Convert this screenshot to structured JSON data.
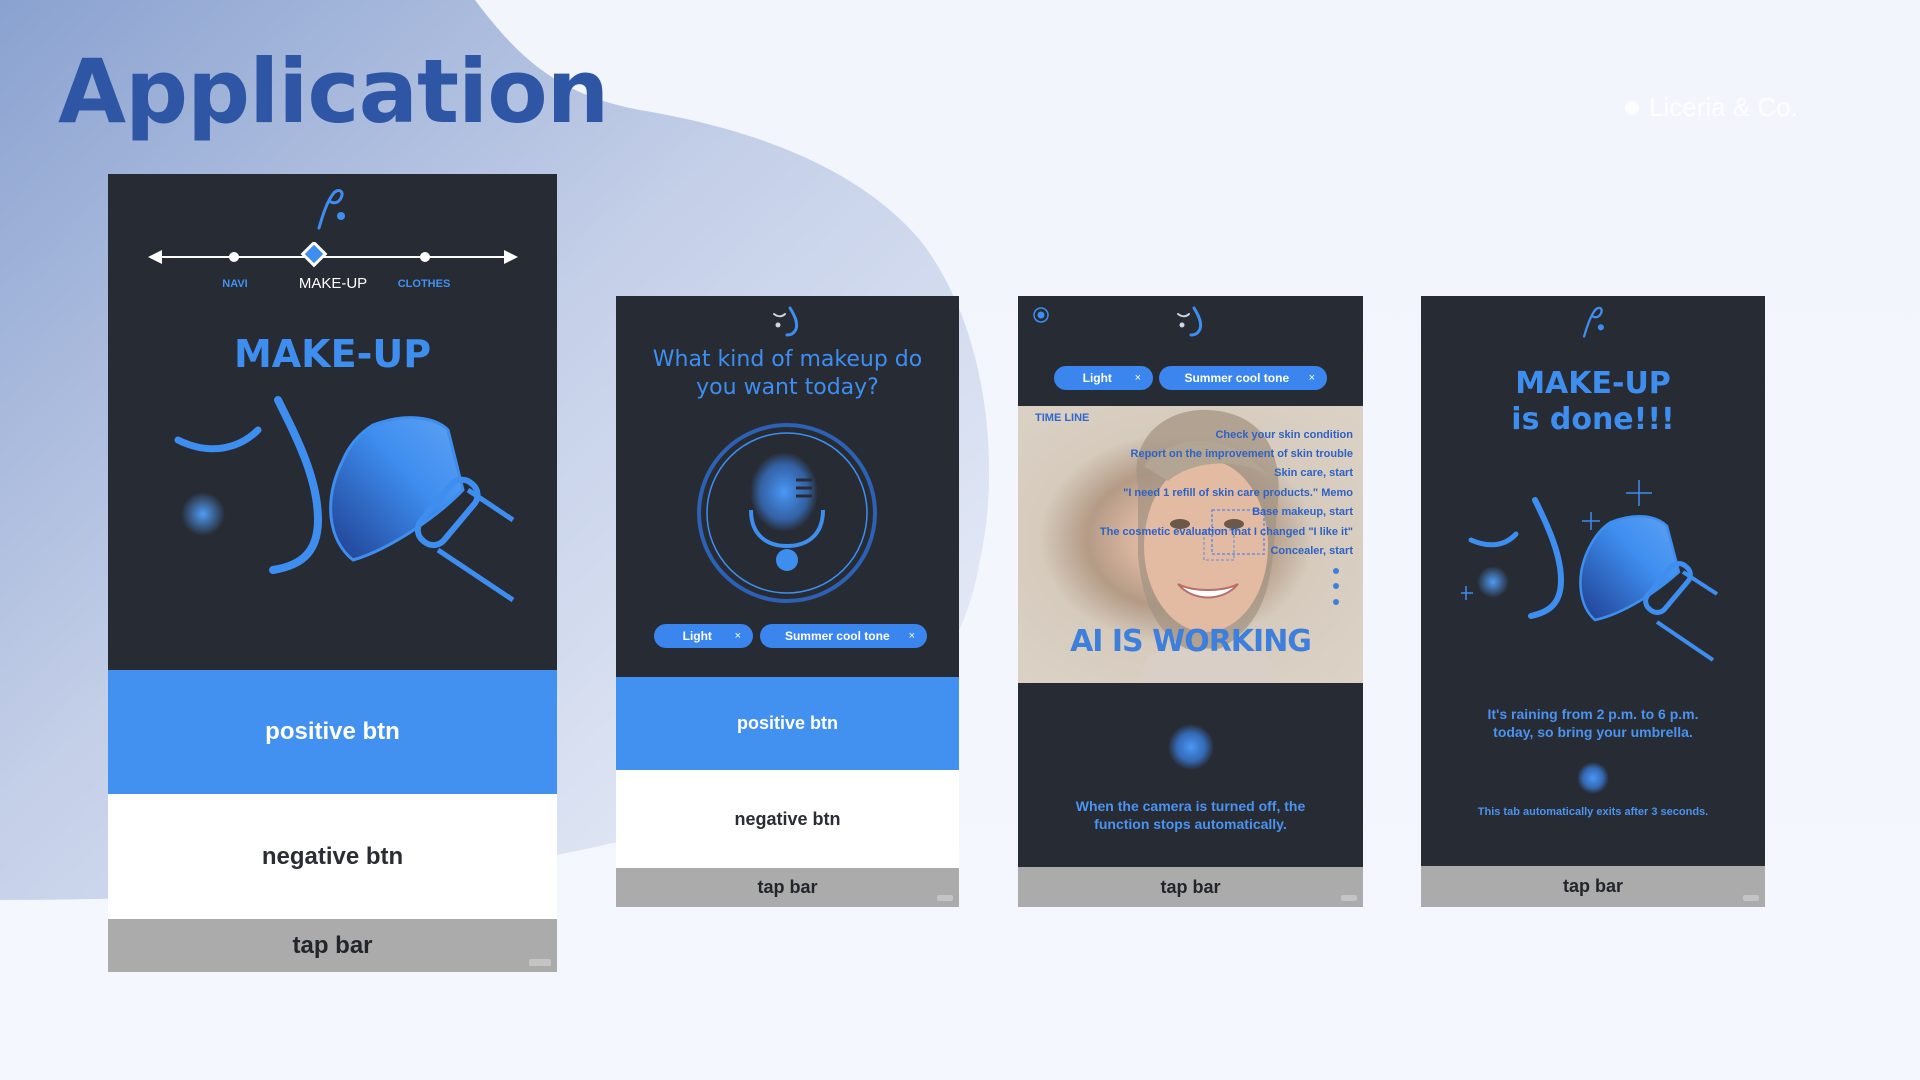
{
  "page": {
    "title": "Application",
    "brand": "Liceria & Co."
  },
  "colors": {
    "accent": "#4291f1",
    "dark": "#272b34",
    "tapbar": "#ababab",
    "title": "#2f56a4"
  },
  "screen1": {
    "nav_labels": [
      "NAVI",
      "MAKE-UP",
      "CLOTHES"
    ],
    "nav_active_index": 1,
    "title": "MAKE-UP",
    "positive_btn": "positive btn",
    "negative_btn": "negative btn",
    "tap_bar": "tap bar"
  },
  "screen2": {
    "question": "What kind of makeup do you want today?",
    "chips": [
      {
        "label": "Light",
        "close": "×"
      },
      {
        "label": "Summer cool tone",
        "close": "×"
      }
    ],
    "positive_btn": "positive btn",
    "negative_btn": "negative btn",
    "tap_bar": "tap bar"
  },
  "screen3": {
    "chips": [
      {
        "label": "Light",
        "close": "×"
      },
      {
        "label": "Summer cool tone",
        "close": "×"
      }
    ],
    "timeline_title": "TIME LINE",
    "timeline": [
      "Check your skin condition",
      "Report on the improvement of skin trouble",
      "Skin care, start",
      "\"I need 1 refill of skin care products.\" Memo",
      "Base makeup, start",
      "The cosmetic evaluation that I changed \"I like it\"",
      "Concealer, start"
    ],
    "status": "AI IS WORKING",
    "message": "When the camera is turned off, the function stops automatically.",
    "tap_bar": "tap bar"
  },
  "screen4": {
    "title_line1": "MAKE-UP",
    "title_line2": "is done!!!",
    "weather": "It's raining from 2 p.m. to 6 p.m. today, so bring your umbrella.",
    "note": "This tab automatically exits after 3 seconds.",
    "tap_bar": "tap bar"
  }
}
